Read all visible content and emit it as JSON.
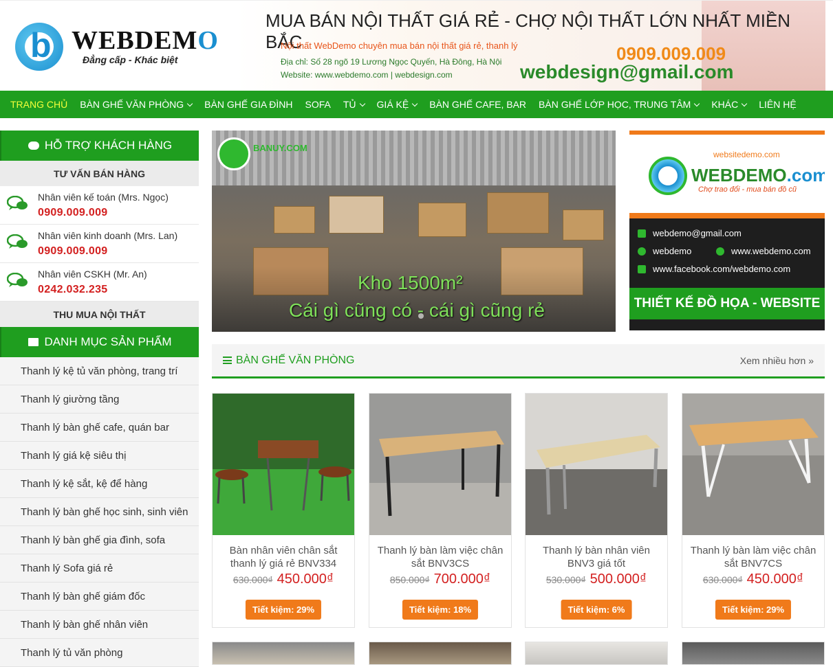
{
  "header": {
    "logo_name": "WEBDEM",
    "logo_name_o": "O",
    "logo_tagline": "Đẳng cấp - Khác biệt",
    "banner_title": "MUA BÁN NỘI THẤT GIÁ RẺ - CHỢ NỘI THẤT LỚN NHẤT MIỀN BẮC",
    "banner_line1": "Nội thất WebDemo chuyên mua bán nội thất giá rẻ, thanh lý",
    "banner_line2": "Địa chỉ: Số 28 ngõ 19 Lương Ngọc Quyến, Hà Đông, Hà Nội",
    "banner_line3": "Website: www.webdemo.com | webdesign.com",
    "banner_phone": "0909.009.009",
    "banner_email": "webdesign@gmail.com"
  },
  "nav": {
    "items": [
      {
        "label": "TRANG CHỦ"
      },
      {
        "label": "BÀN GHẾ VĂN PHÒNG"
      },
      {
        "label": "BÀN GHẾ GIA ĐÌNH"
      },
      {
        "label": "SOFA"
      },
      {
        "label": "TỦ"
      },
      {
        "label": "GIÁ KỆ"
      },
      {
        "label": "BÀN GHẾ CAFE, BAR"
      },
      {
        "label": "BÀN GHẾ LỚP HỌC, TRUNG TÂM"
      },
      {
        "label": "KHÁC"
      },
      {
        "label": "LIÊN HỆ"
      }
    ]
  },
  "sidebar": {
    "support_title": "HỖ TRỢ KHÁCH HÀNG",
    "sales_title": "TƯ VẤN BÁN HÀNG",
    "staff": [
      {
        "name": "Nhân viên kế toán (Mrs. Ngọc)",
        "phone": "0909.009.009"
      },
      {
        "name": "Nhân viên kinh doanh (Mrs. Lan)",
        "phone": "0909.009.009"
      },
      {
        "name": "Nhân viên CSKH (Mr. An)",
        "phone": "0242.032.235"
      }
    ],
    "buy_title": "THU MUA NỘI THẤT",
    "category_title": "DANH MỤC SẢN PHẨM",
    "categories": [
      "Thanh lý kệ tủ văn phòng, trang trí",
      "Thanh lý giường tầng",
      "Thanh lý bàn ghế cafe, quán bar",
      "Thanh lý giá kệ siêu thị",
      "Thanh lý kệ sắt, kệ để hàng",
      "Thanh lý bàn ghế học sinh, sinh viên",
      "Thanh lý bàn ghế gia đình, sofa",
      "Thanh lý Sofa giá rẻ",
      "Thanh lý bàn ghế giám đốc",
      "Thanh lý bàn ghế nhân viên",
      "Thanh lý tủ văn phòng"
    ]
  },
  "slider": {
    "logo_text": "BANUY.COM",
    "line1": "Kho 1500m²",
    "line2": "Cái gì cũng có - cái gì cũng rẻ"
  },
  "ad": {
    "site": "websitedemo.com",
    "name_main": "WEBDEMO",
    "name_suffix": ".com",
    "slogan": "Chợ trao đổi - mua bán đồ cũ",
    "email": "webdemo@gmail.com",
    "skype": "webdemo",
    "website": "www.webdemo.com",
    "facebook": "www.facebook.com/webdemo.com",
    "bottom": "THIẾT KẾ ĐỒ HỌA - WEBSITE"
  },
  "section": {
    "title": "BÀN GHẾ VĂN PHÒNG",
    "more": "Xem nhiều hơn »"
  },
  "products": [
    {
      "name": "Bàn nhân viên chân sắt thanh lý giá rẻ BNV334",
      "old_price": "630.000₫",
      "price": "450.000₫",
      "save": "Tiết kiệm: 29%"
    },
    {
      "name": "Thanh lý bàn làm việc chân sắt BNV3CS",
      "old_price": "850.000₫",
      "price": "700.000₫",
      "save": "Tiết kiệm: 18%"
    },
    {
      "name": "Thanh lý bàn nhân viên BNV3 giá tốt",
      "old_price": "530.000₫",
      "price": "500.000₫",
      "save": "Tiết kiệm: 6%"
    },
    {
      "name": "Thanh lý bàn làm việc chân sắt BNV7CS",
      "old_price": "630.000₫",
      "price": "450.000₫",
      "save": "Tiết kiệm: 29%"
    }
  ],
  "colors": {
    "primary_green": "#1f9e1f",
    "accent_orange": "#f07a1a",
    "price_red": "#d32020",
    "nav_active": "#f4ff3a"
  }
}
